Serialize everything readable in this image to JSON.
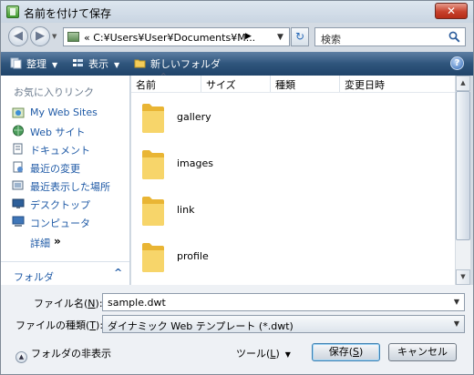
{
  "window": {
    "title": "名前を付けて保存",
    "close_label": "✕"
  },
  "address_bar": {
    "path": "« C:¥Users¥User¥Documents¥M...",
    "search_placeholder": "検索"
  },
  "toolbar": {
    "organize_label": "整理",
    "views_label": "表示",
    "new_folder_label": "新しいフォルダ",
    "help_label": "?"
  },
  "favorites": {
    "header": "お気に入りリンク",
    "items": [
      {
        "label": "My Web Sites",
        "icon": "web-sites-icon"
      },
      {
        "label": "Web サイト",
        "icon": "globe-icon"
      },
      {
        "label": "ドキュメント",
        "icon": "documents-icon"
      },
      {
        "label": "最近の変更",
        "icon": "recent-changes-icon"
      },
      {
        "label": "最近表示した場所",
        "icon": "recent-places-icon"
      },
      {
        "label": "デスクトップ",
        "icon": "desktop-icon"
      },
      {
        "label": "コンピュータ",
        "icon": "computer-icon"
      }
    ],
    "more_label": "詳細",
    "more_chevron": "»",
    "folders_label": "フォルダ",
    "folders_chevron": "^"
  },
  "file_list": {
    "columns": [
      "名前",
      "サイズ",
      "種類",
      "変更日時"
    ],
    "sort_indicator": "^",
    "items": [
      {
        "name": "gallery"
      },
      {
        "name": "images"
      },
      {
        "name": "link"
      },
      {
        "name": "profile"
      }
    ]
  },
  "form": {
    "filename_label_pre": "ファイル名(",
    "filename_label_key": "N",
    "filename_label_post": "):",
    "filename_value": "sample.dwt",
    "filetype_label_pre": "ファイルの種類(",
    "filetype_label_key": "T",
    "filetype_label_post": "):",
    "filetype_value": "ダイナミック Web テンプレート (*.dwt)",
    "hide_folders_label": "フォルダの非表示",
    "tools_label_pre": "ツール(",
    "tools_label_key": "L",
    "tools_label_post": ")",
    "save_label_pre": "保存(",
    "save_label_key": "S",
    "save_label_post": ")",
    "cancel_label": "キャンセル"
  },
  "colors": {
    "toolbar": "#2f557c",
    "link": "#1f5aa6",
    "folder": "#f2c94c"
  }
}
